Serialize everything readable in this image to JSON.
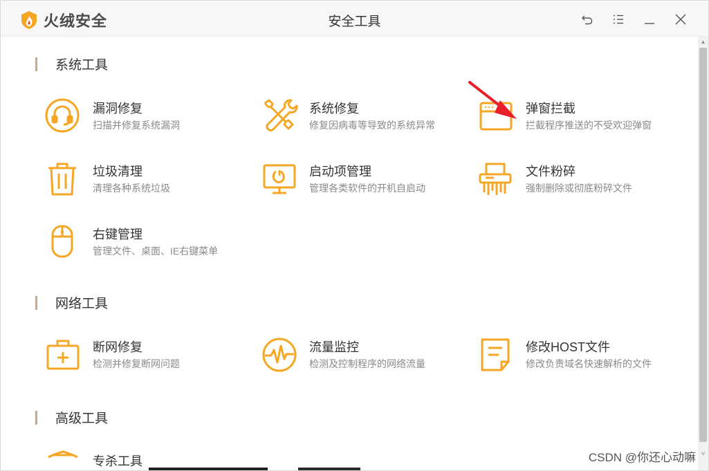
{
  "app": {
    "logo_text": "火绒安全",
    "window_title": "安全工具",
    "controls": [
      {
        "name": "back-icon"
      },
      {
        "name": "menu-icon"
      },
      {
        "name": "minimize-icon"
      },
      {
        "name": "close-icon"
      }
    ]
  },
  "sections": [
    {
      "title": "系统工具",
      "tools": [
        {
          "title": "漏洞修复",
          "desc": "扫描并修复系统漏洞",
          "icon": "vulnerability-repair-icon"
        },
        {
          "title": "系统修复",
          "desc": "修复因病毒等导致的系统异常",
          "icon": "wrench-screwdriver-icon"
        },
        {
          "title": "弹窗拦截",
          "desc": "拦截程序推送的不受欢迎弹窗",
          "icon": "popup-window-icon"
        },
        {
          "title": "垃圾清理",
          "desc": "清理各种系统垃圾",
          "icon": "trash-bin-icon"
        },
        {
          "title": "启动项管理",
          "desc": "管理各类软件的开机自启动",
          "icon": "monitor-power-icon"
        },
        {
          "title": "文件粉碎",
          "desc": "强制删除或彻底粉碎文件",
          "icon": "shredder-icon"
        },
        {
          "title": "右键管理",
          "desc": "管理文件、桌面、IE右键菜单",
          "icon": "mouse-icon"
        }
      ]
    },
    {
      "title": "网络工具",
      "tools": [
        {
          "title": "断网修复",
          "desc": "检测并修复断网问题",
          "icon": "first-aid-kit-icon"
        },
        {
          "title": "流量监控",
          "desc": "检测及控制程序的网络流量",
          "icon": "pulse-monitor-icon"
        },
        {
          "title": "修改HOST文件",
          "desc": "修改负责域名快速解析的文件",
          "icon": "document-edit-icon"
        }
      ]
    },
    {
      "title": "高级工具",
      "tools": [
        {
          "title": "专杀工具",
          "desc": "",
          "icon": "shield-icon"
        }
      ]
    }
  ],
  "watermark": "CSDN @你还心动嘛",
  "colors": {
    "accent": "#f5a623",
    "section_bar": "#c9a98a",
    "arrow": "#e8202a"
  }
}
